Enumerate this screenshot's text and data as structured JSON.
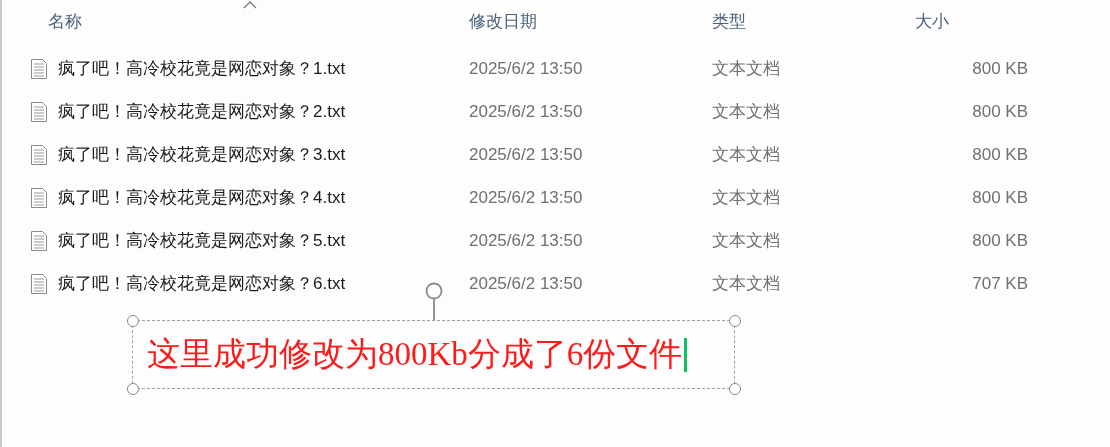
{
  "columns": [
    {
      "label": "名称",
      "sorted": true
    },
    {
      "label": "修改日期",
      "sorted": false
    },
    {
      "label": "类型",
      "sorted": false
    },
    {
      "label": "大小",
      "sorted": false
    }
  ],
  "files": [
    {
      "name": "疯了吧！高冷校花竟是网恋对象？1.txt",
      "modified": "2025/6/2 13:50",
      "type": "文本文档",
      "size": "800 KB"
    },
    {
      "name": "疯了吧！高冷校花竟是网恋对象？2.txt",
      "modified": "2025/6/2 13:50",
      "type": "文本文档",
      "size": "800 KB"
    },
    {
      "name": "疯了吧！高冷校花竟是网恋对象？3.txt",
      "modified": "2025/6/2 13:50",
      "type": "文本文档",
      "size": "800 KB"
    },
    {
      "name": "疯了吧！高冷校花竟是网恋对象？4.txt",
      "modified": "2025/6/2 13:50",
      "type": "文本文档",
      "size": "800 KB"
    },
    {
      "name": "疯了吧！高冷校花竟是网恋对象？5.txt",
      "modified": "2025/6/2 13:50",
      "type": "文本文档",
      "size": "800 KB"
    },
    {
      "name": "疯了吧！高冷校花竟是网恋对象？6.txt",
      "modified": "2025/6/2 13:50",
      "type": "文本文档",
      "size": "707 KB"
    }
  ],
  "annotation": {
    "text": "这里成功修改为800Kb分成了6份文件",
    "editing": true
  }
}
